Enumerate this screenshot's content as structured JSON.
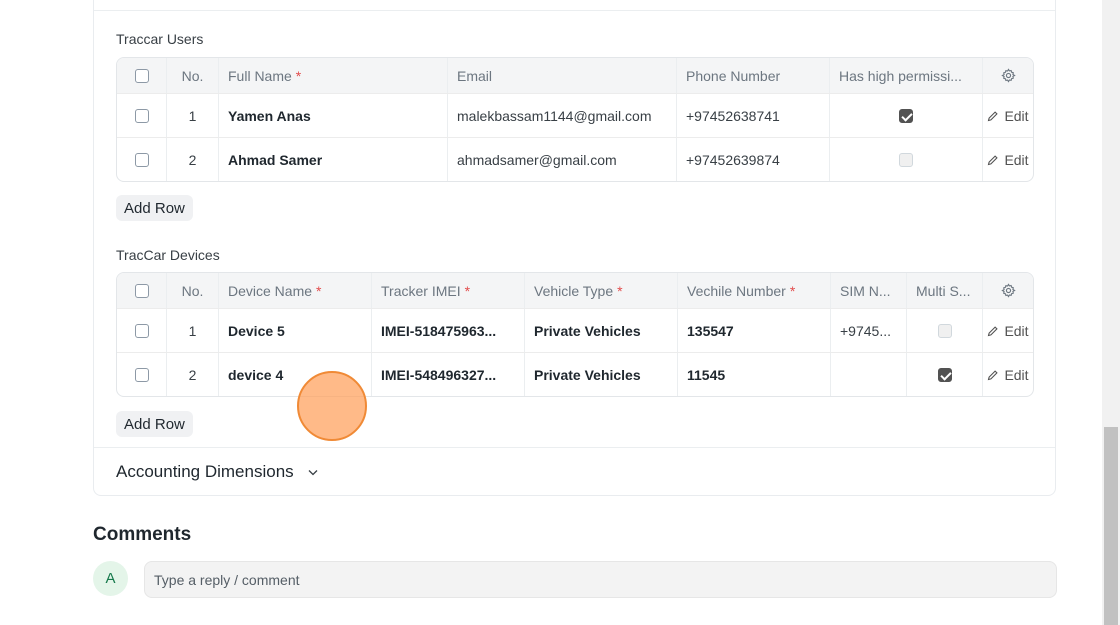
{
  "users": {
    "section_label": "Traccar Users",
    "columns": [
      "No.",
      "Full Name",
      "Email",
      "Phone Number",
      "Has high permissi..."
    ],
    "required_marker": "*",
    "rows": [
      {
        "no": "1",
        "full_name": "Yamen Anas",
        "email": "malekbassam1144@gmail.com",
        "phone": "+97452638741",
        "high_permission": true,
        "edit": "Edit"
      },
      {
        "no": "2",
        "full_name": "Ahmad Samer",
        "email": "ahmadsamer@gmail.com",
        "phone": "+97452639874",
        "high_permission": false,
        "edit": "Edit"
      }
    ],
    "add_row": "Add Row"
  },
  "devices": {
    "section_label": "TracCar Devices",
    "columns": [
      "No.",
      "Device Name",
      "Tracker IMEI",
      "Vehicle Type",
      "Vechile Number",
      "SIM N...",
      "Multi S..."
    ],
    "required_marker": "*",
    "rows": [
      {
        "no": "1",
        "device_name": "Device 5",
        "imei": "IMEI-518475963...",
        "vehicle_type": "Private Vehicles",
        "vehicle_number": "135547",
        "sim": "+9745...",
        "multi": false,
        "edit": "Edit"
      },
      {
        "no": "2",
        "device_name": "device 4",
        "imei": "IMEI-548496327...",
        "vehicle_type": "Private Vehicles",
        "vehicle_number": "11545",
        "sim": "",
        "multi": true,
        "edit": "Edit"
      }
    ],
    "add_row": "Add Row"
  },
  "accounting": {
    "title": "Accounting Dimensions"
  },
  "comments": {
    "title": "Comments",
    "avatar_initial": "A",
    "placeholder": "Type a reply / comment"
  },
  "colors": {
    "required": "#e24c4c",
    "avatar_bg": "#e4f5e9",
    "avatar_text": "#16794c",
    "touch_indicator": "#f08a36"
  },
  "icons": [
    "settings-gear-icon",
    "pencil-edit-icon",
    "chevron-down-icon"
  ]
}
